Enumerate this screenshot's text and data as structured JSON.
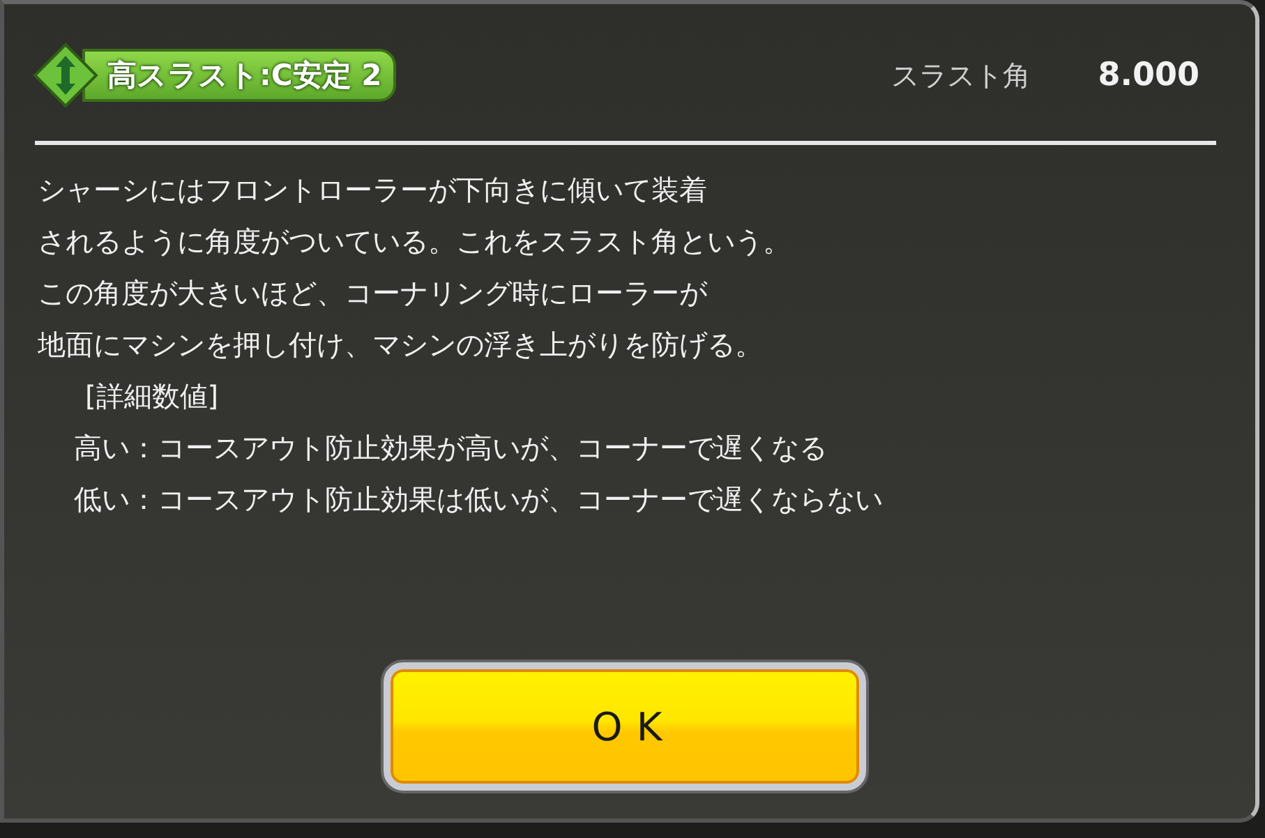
{
  "header": {
    "badge": "高スラスト:C安定 2",
    "stat_label": "スラスト角",
    "stat_value": "8.000"
  },
  "description": [
    {
      "kind": "body",
      "text": "シャーシにはフロントローラーが下向きに傾いて装着"
    },
    {
      "kind": "body",
      "text": "されるように角度がついている。これをスラスト角という。"
    },
    {
      "kind": "body",
      "text": "この角度が大きいほど、コーナリング時にローラーが"
    },
    {
      "kind": "body",
      "text": "地面にマシンを押し付け、マシンの浮き上がりを防げる。"
    },
    {
      "kind": "heading",
      "text": "[詳細数値]"
    },
    {
      "kind": "detail",
      "text": "高い：コースアウト防止効果が高いが、コーナーで遅くなる"
    },
    {
      "kind": "detail",
      "text": "低い：コースアウト防止効果は低いが、コーナーで遅くならない"
    }
  ],
  "buttons": [
    "OK"
  ]
}
